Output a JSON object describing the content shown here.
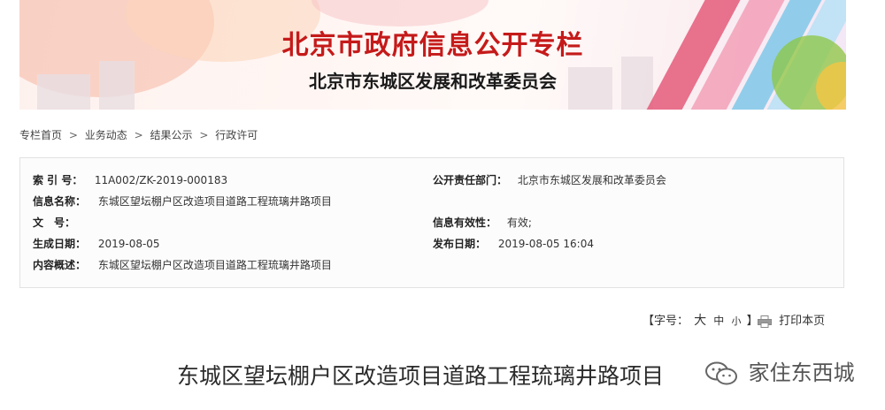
{
  "banner": {
    "title": "北京市政府信息公开专栏",
    "subtitle": "北京市东城区发展和改革委员会"
  },
  "breadcrumb": [
    "专栏首页",
    "业务动态",
    "结果公示",
    "行政许可"
  ],
  "breadcrumb_sep": ">",
  "info": {
    "index_label": "索 引 号：",
    "index_value": "11A002/ZK-2019-000183",
    "dept_label": "公开责任部门：",
    "dept_value": "北京市东城区发展和改革委员会",
    "name_label": "信息名称：",
    "name_value": "东城区望坛棚户区改造项目道路工程琉璃井路项目",
    "docno_label": "文　号：",
    "docno_value": "",
    "validity_label": "信息有效性：",
    "validity_value": "有效;",
    "created_label": "生成日期：",
    "created_value": "2019-08-05",
    "published_label": "发布日期：",
    "published_value": "2019-08-05 16:04",
    "summary_label": "内容概述：",
    "summary_value": "东城区望坛棚户区改造项目道路工程琉璃井路项目"
  },
  "tools": {
    "font_open": "【字号：",
    "font_large": "大",
    "font_medium": "中",
    "font_small": "小",
    "font_close": "】",
    "print_label": "打印本页"
  },
  "document": {
    "title": "东城区望坛棚户区改造项目道路工程琉璃井路项目"
  },
  "watermark": {
    "text": "家住东西城"
  },
  "colors": {
    "title_red": "#c51a1a",
    "box_border": "#e2e2e2"
  }
}
